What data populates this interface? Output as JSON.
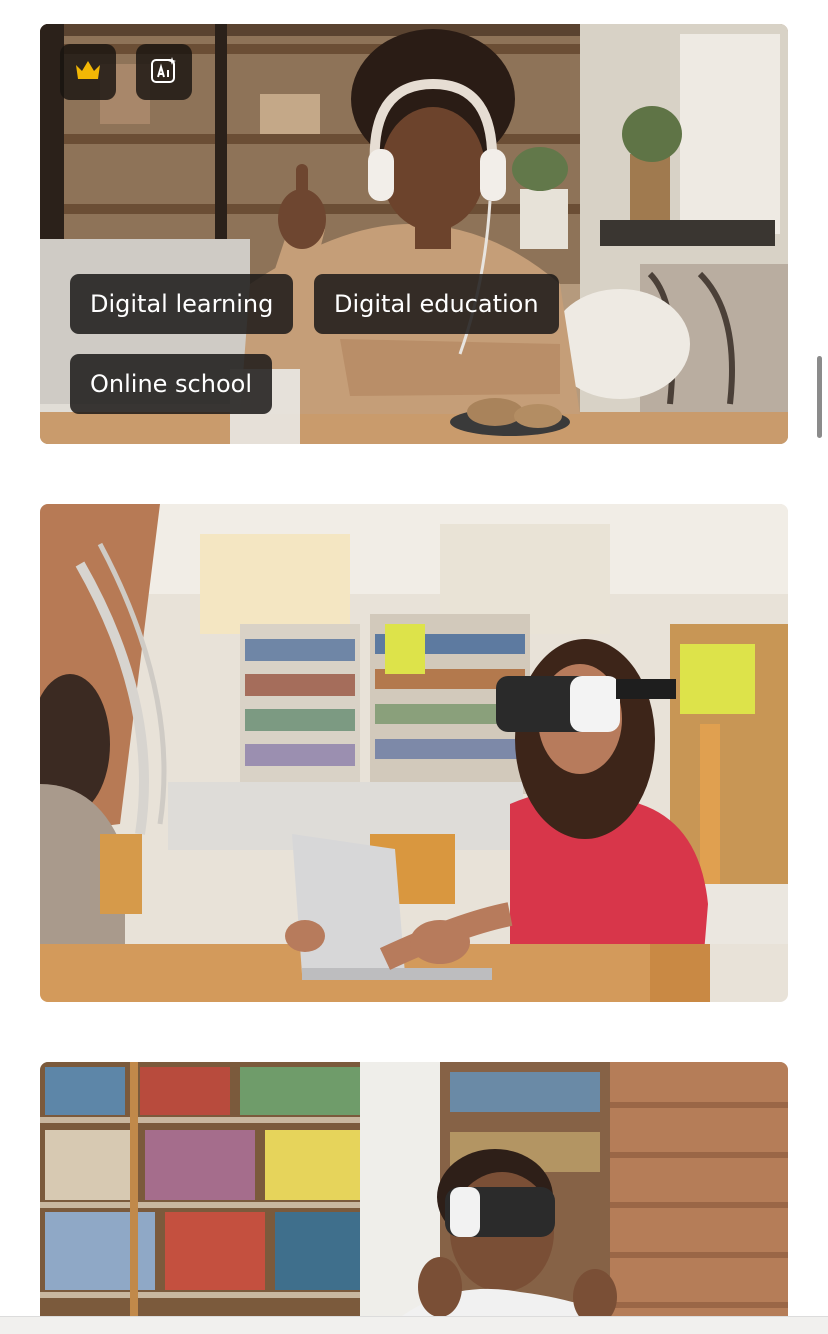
{
  "results": [
    {
      "premium_icon": "crown-icon",
      "ai_icon": "ai-sparkle-icon",
      "tags": [
        "Digital learning",
        "Digital education",
        "Online school"
      ]
    },
    {},
    {}
  ],
  "colors": {
    "badge_background": "#1c1915",
    "crown": "#f2b705",
    "tag_background": "#1c1a18",
    "tag_text": "#ffffff",
    "scrollbar": "#8b8b8b"
  }
}
